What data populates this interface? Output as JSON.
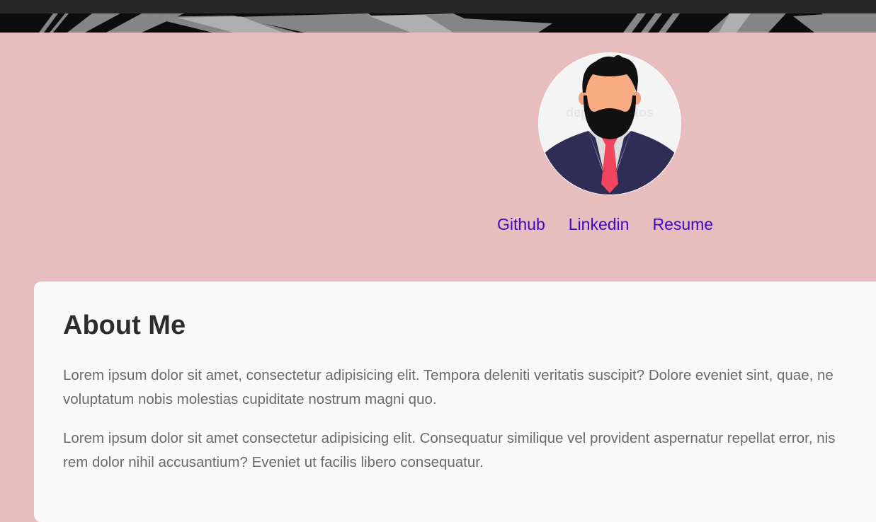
{
  "profile": {
    "avatar_icon": "bearded-man-avatar-icon",
    "watermark": "depositphotos"
  },
  "links": {
    "github": "Github",
    "linkedin": "Linkedin",
    "resume": "Resume"
  },
  "about": {
    "heading": "About Me",
    "paragraph1_line1": "Lorem ipsum dolor sit amet, consectetur adipisicing elit. Tempora deleniti veritatis suscipit? Dolore eveniet sint, quae, ne",
    "paragraph1_line2": "voluptatum nobis molestias cupiditate nostrum magni quo.",
    "paragraph2_line1": "Lorem ipsum dolor sit amet consectetur adipisicing elit. Consequatur similique vel provident aspernatur repellat error, nis",
    "paragraph2_line2": "rem dolor nihil accusantium? Eveniet ut facilis libero consequatur."
  },
  "colors": {
    "page_background": "#e7bdbe",
    "link": "#3a0ac7",
    "card": "#f9f9f9",
    "heading": "#2d2d2d",
    "body_text": "#6a6a6a"
  }
}
